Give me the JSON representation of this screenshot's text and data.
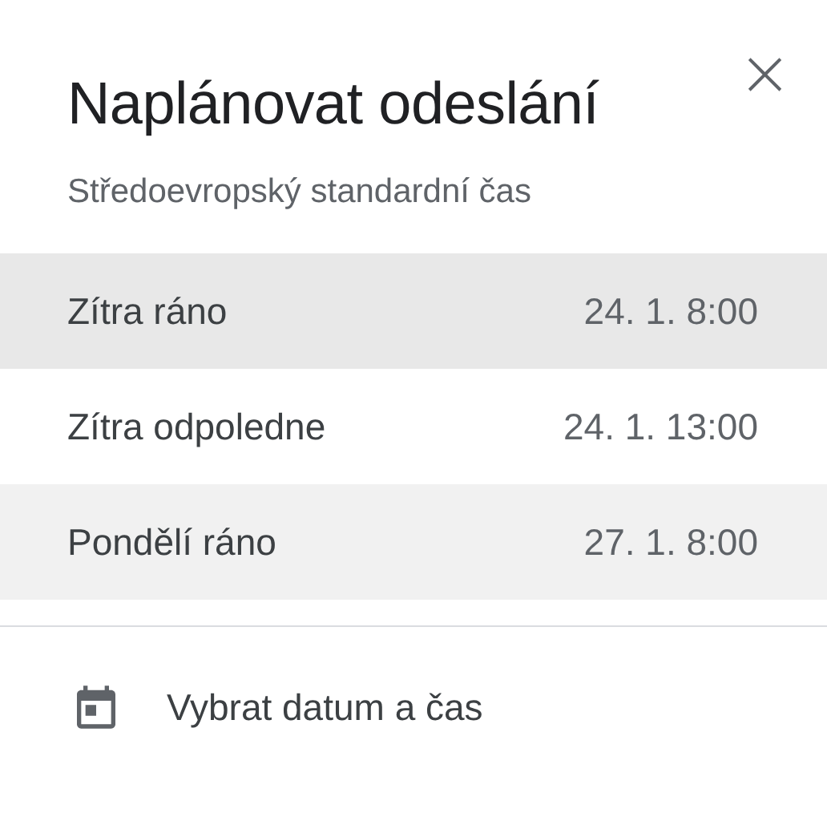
{
  "dialog": {
    "title": "Naplánovat odeslání",
    "close": "×",
    "subtitle": "Středoevropský standardní čas"
  },
  "options": [
    {
      "label": "Zítra ráno",
      "time": "24. 1. 8:00",
      "selected": true,
      "hovered": false
    },
    {
      "label": "Zítra odpoledne",
      "time": "24. 1. 13:00",
      "selected": false,
      "hovered": false
    },
    {
      "label": "Pondělí ráno",
      "time": "27. 1. 8:00",
      "selected": false,
      "hovered": true
    }
  ],
  "custom": {
    "label": "Vybrat datum a čas"
  }
}
